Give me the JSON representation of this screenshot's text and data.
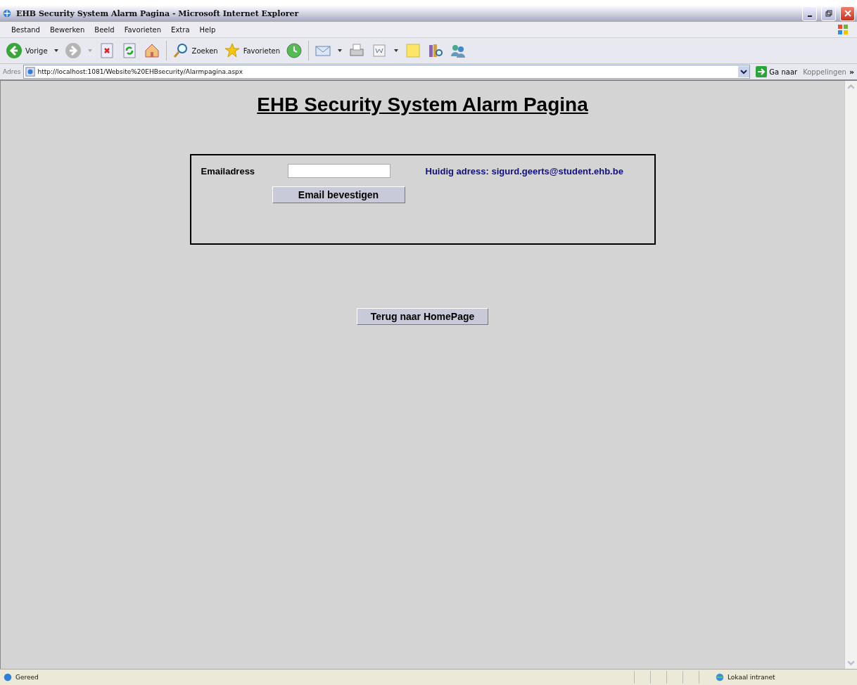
{
  "window": {
    "title": "EHB Security System Alarm Pagina - Microsoft Internet Explorer"
  },
  "menu": [
    "Bestand",
    "Bewerken",
    "Beeld",
    "Favorieten",
    "Extra",
    "Help"
  ],
  "toolbar": {
    "back": "Vorige",
    "search": "Zoeken",
    "favorites": "Favorieten"
  },
  "address_bar": {
    "label": "Adres",
    "url": "http://localhost:1081/Website%20EHBsecurity/Alarmpagina.aspx",
    "go": "Ga naar",
    "links": "Koppelingen",
    "more": "»"
  },
  "page": {
    "heading": "EHB Security System Alarm Pagina",
    "form": {
      "label": "Emailadress",
      "current": "Huidig adress: sigurd.geerts@student.ehb.be",
      "confirm": "Email bevestigen"
    },
    "home_button": "Terug naar HomePage"
  },
  "status_bar": {
    "text": "Gereed",
    "zone": "Lokaal intranet"
  }
}
